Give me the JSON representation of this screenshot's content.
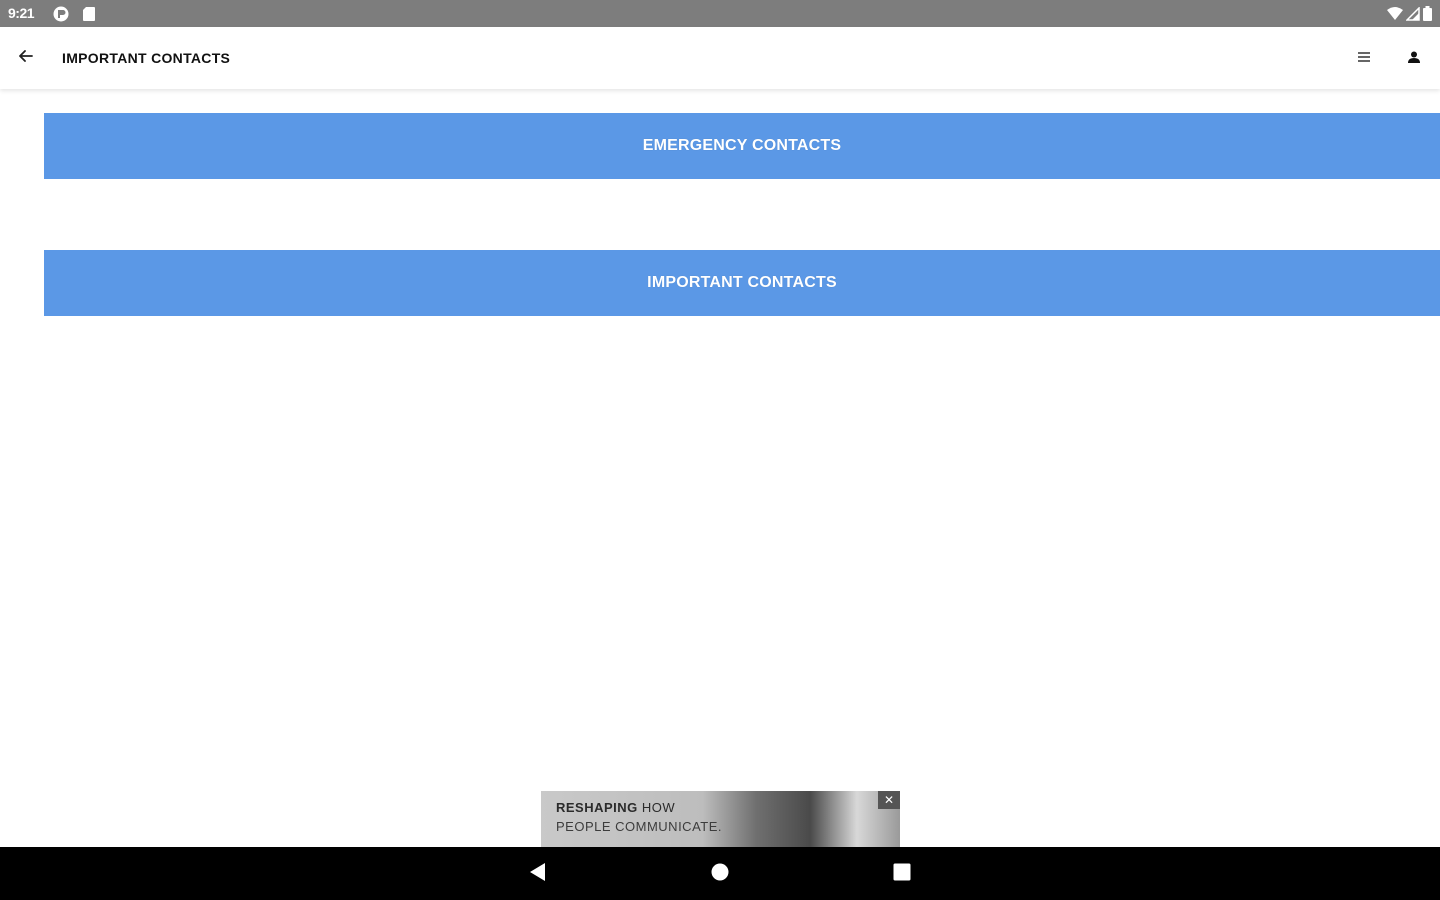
{
  "status_bar": {
    "time": "9:21",
    "icons": [
      "app-notification-icon",
      "sd-card-icon",
      "wifi-icon",
      "signal-icon",
      "battery-icon"
    ]
  },
  "app_bar": {
    "title": "IMPORTANT CONTACTS",
    "back_icon": "arrow-back-icon",
    "menu_icon": "menu-icon",
    "account_icon": "person-icon"
  },
  "buttons": [
    {
      "label": "EMERGENCY CONTACTS"
    },
    {
      "label": "IMPORTANT CONTACTS"
    }
  ],
  "ad": {
    "line1_bold": "RESHAPING",
    "line1_rest": " HOW",
    "line2": "PEOPLE COMMUNICATE.",
    "close_label": "✕"
  },
  "nav_bar": {
    "icons": [
      "nav-back-icon",
      "nav-home-icon",
      "nav-recents-icon"
    ]
  },
  "colors": {
    "accent": "#5b98e6",
    "status_bar": "#7d7d7d",
    "nav_bar": "#000000"
  }
}
